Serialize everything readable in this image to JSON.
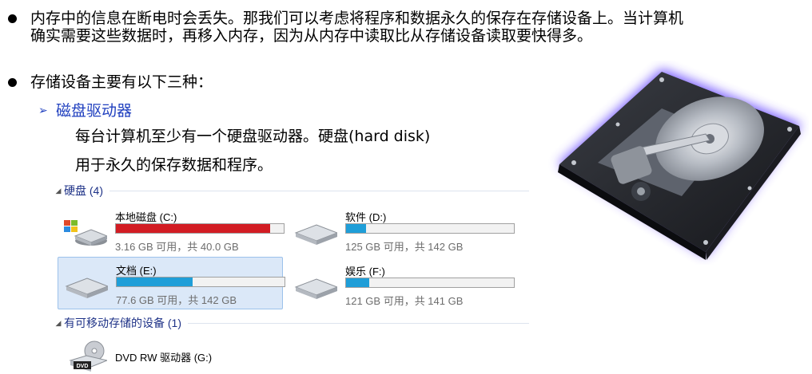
{
  "bullets": [
    {
      "line1": "内存中的信息在断电时会丢失。那我们可以考虑将程序和数据永久的保存在存储设备上。当计算机",
      "line2": "确实需要这些数据时，再移入内存，因为从内存中读取比从存储设备读取要快得多。"
    },
    {
      "line1": "存储设备主要有以下三种："
    }
  ],
  "sub_item": {
    "arrow": "➢",
    "label": "磁盘驱动器",
    "desc1": "每台计算机至少有一个硬盘驱动器。硬盘(hard disk)",
    "desc2": "用于永久的保存数据和程序。"
  },
  "explorer": {
    "hard_disks_header": "硬盘 (4)",
    "removable_header": "有可移动存储的设备 (1)",
    "drives": [
      {
        "name": "本地磁盘 (C:)",
        "free_text": "3.16 GB 可用，共 40.0 GB",
        "used_fraction": 0.92,
        "bar_color": "#d21c23",
        "selected": false
      },
      {
        "name": "软件 (D:)",
        "free_text": "125 GB 可用，共 142 GB",
        "used_fraction": 0.12,
        "bar_color": "#1f9ed8",
        "selected": false
      },
      {
        "name": "文档 (E:)",
        "free_text": "77.6 GB 可用，共 142 GB",
        "used_fraction": 0.45,
        "bar_color": "#1f9ed8",
        "selected": true
      },
      {
        "name": "娱乐 (F:)",
        "free_text": "121 GB 可用，共 141 GB",
        "used_fraction": 0.14,
        "bar_color": "#1f9ed8",
        "selected": false
      }
    ],
    "removable": {
      "name": "DVD RW 驱动器 (G:)",
      "icon_label": "DVD"
    }
  }
}
